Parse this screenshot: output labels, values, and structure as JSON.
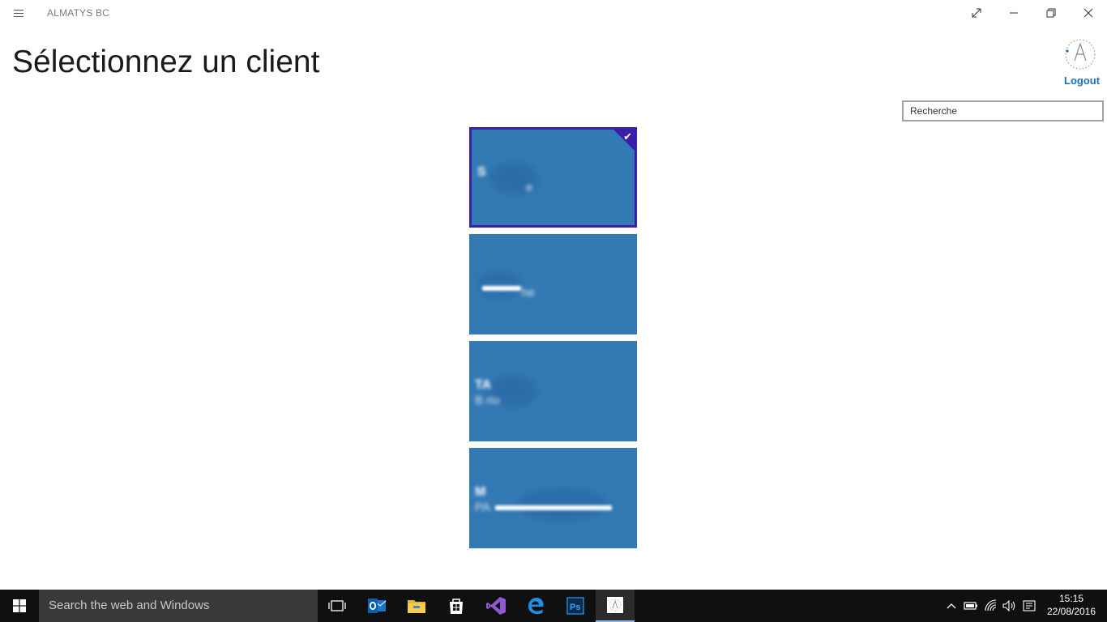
{
  "window": {
    "app_title": "ALMATYS BC"
  },
  "page": {
    "title": "Sélectionnez un client"
  },
  "user": {
    "logout_label": "Logout"
  },
  "search": {
    "placeholder": "Recherche"
  },
  "clients": [
    {
      "name": "S",
      "sub": "e",
      "selected": true
    },
    {
      "name": "",
      "sub": "he",
      "selected": false
    },
    {
      "name": "TA",
      "sub": "B rio",
      "selected": false
    },
    {
      "name": "M",
      "sub": "PA",
      "selected": false
    }
  ],
  "taskbar": {
    "search_placeholder": "Search the web and Windows",
    "apps": [
      "task-view-icon",
      "outlook-icon",
      "file-explorer-icon",
      "store-icon",
      "visual-studio-icon",
      "edge-icon",
      "photoshop-icon",
      "almatys-app-icon"
    ],
    "photoshop_label": "Ps",
    "time": "15:15",
    "date": "22/08/2016"
  },
  "colors": {
    "tile": "#3379b4",
    "selected_border": "#3a1fa8",
    "accent": "#1f6fb5",
    "taskbar": "#101010"
  }
}
